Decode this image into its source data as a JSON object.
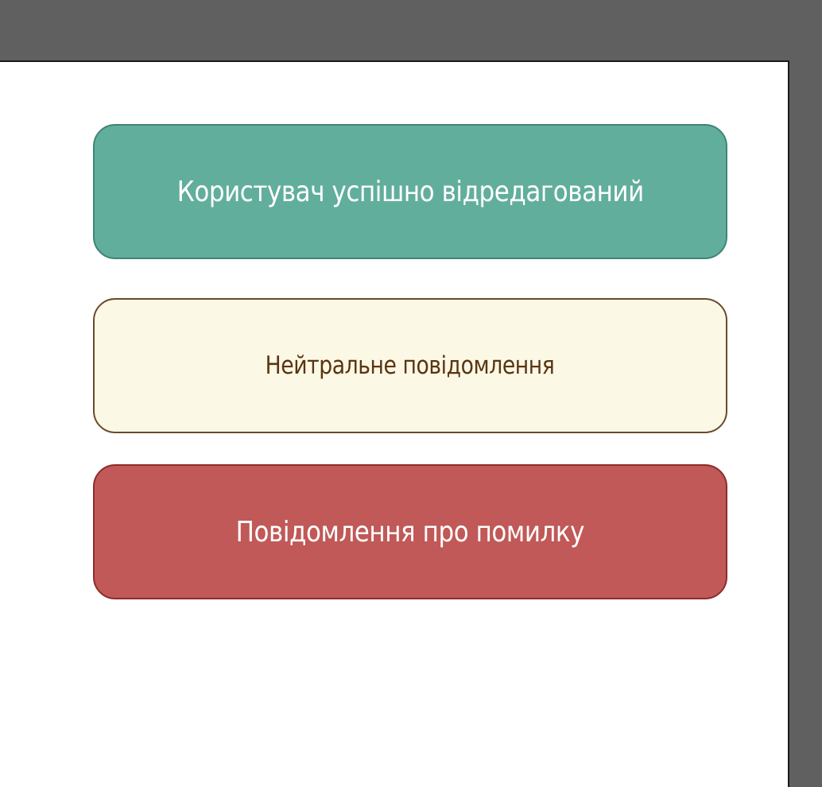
{
  "alerts": {
    "success": {
      "text": "Користувач успішно відредагований",
      "background": "#62ae9d",
      "border": "#3e8577",
      "text_color": "#ffffff"
    },
    "neutral": {
      "text": "Нейтральне повідомлення",
      "background": "#fcf8e6",
      "border": "#6a4a2a",
      "text_color": "#5a3510"
    },
    "error": {
      "text": "Повідомлення про помилку",
      "background": "#c05957",
      "border": "#8e2c2b",
      "text_color": "#ffffff"
    }
  }
}
